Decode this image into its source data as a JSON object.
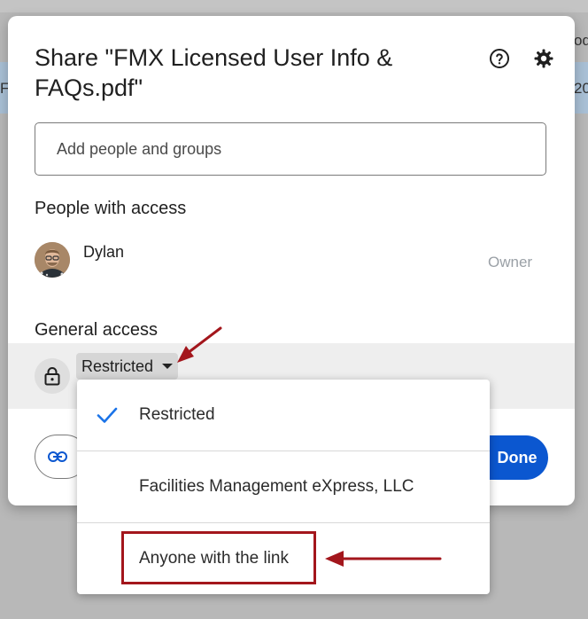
{
  "background": {
    "left_text": "F",
    "right_text": "20",
    "top_right_text": "od"
  },
  "dialog": {
    "title": "Share \"FMX Licensed User Info & FAQs.pdf\"",
    "help_icon": "help-circle-icon",
    "settings_icon": "gear-icon",
    "add_people": {
      "placeholder": "Add people and groups",
      "value": ""
    },
    "people_section_label": "People with access",
    "people": [
      {
        "name": "Dylan",
        "role": "Owner"
      }
    ],
    "general_access_label": "General access",
    "access_value": "Restricted",
    "done_label": "Done"
  },
  "access_menu": {
    "items": [
      {
        "label": "Restricted",
        "selected": true
      },
      {
        "label": "Facilities Management eXpress, LLC",
        "selected": false
      },
      {
        "label": "Anyone with the link",
        "selected": false
      }
    ]
  },
  "colors": {
    "accent": "#0b57d0",
    "annotation": "#a3161c",
    "check": "#1a73e8"
  }
}
